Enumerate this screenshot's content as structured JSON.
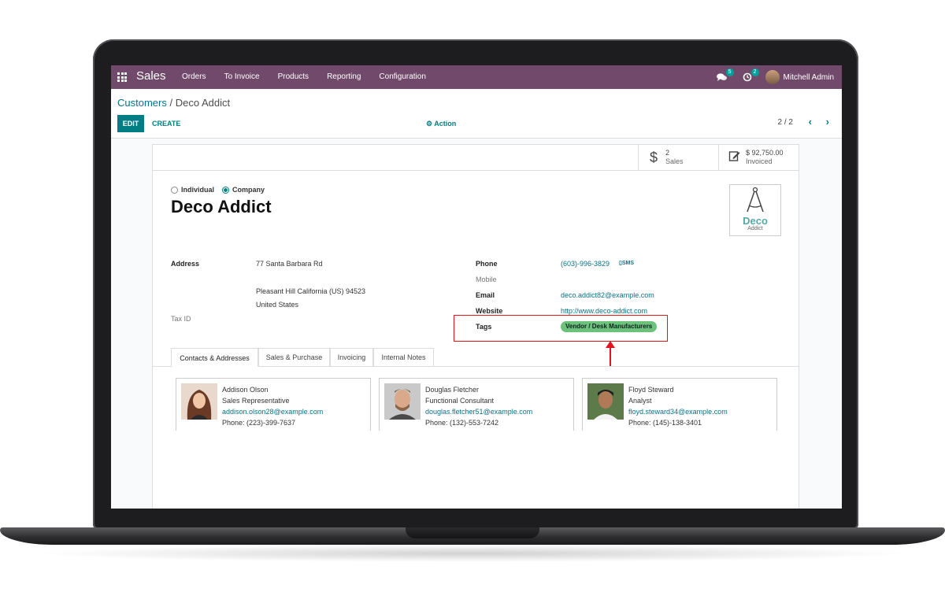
{
  "navbar": {
    "app_name": "Sales",
    "menu": [
      "Orders",
      "To Invoice",
      "Products",
      "Reporting",
      "Configuration"
    ],
    "messages_count": "5",
    "activities_count": "2",
    "user_name": "Mitchell Admin"
  },
  "control": {
    "breadcrumb_parent": "Customers",
    "breadcrumb_separator": " / ",
    "breadcrumb_current": "Deco Addict",
    "edit_label": "EDIT",
    "create_label": "CREATE",
    "action_label": "Action",
    "pager": "2 / 2"
  },
  "stats": {
    "sales_value": "2",
    "sales_label": "Sales",
    "invoiced_value": "$ 92,750.00",
    "invoiced_label": "Invoiced"
  },
  "form": {
    "type_individual": "Individual",
    "type_company": "Company",
    "company_name": "Deco Addict",
    "logo_word": "Deco",
    "logo_sub": "Addict",
    "address_label": "Address",
    "street": "77 Santa Barbara Rd",
    "city_line": "Pleasant Hill  California (US)  94523",
    "country": "United States",
    "taxid_label": "Tax ID",
    "phone_label": "Phone",
    "phone": "(603)-996-3829",
    "sms_label": "SMS",
    "mobile_label": "Mobile",
    "email_label": "Email",
    "email": "deco.addict82@example.com",
    "website_label": "Website",
    "website": "http://www.deco-addict.com",
    "tags_label": "Tags",
    "tag": "Vendor / Desk Manufacturers",
    "tag_color": "#6cc17b",
    "highlight_color": "#e0151d"
  },
  "tabs": [
    "Contacts & Addresses",
    "Sales & Purchase",
    "Invoicing",
    "Internal Notes"
  ],
  "contacts": [
    {
      "name": "Addison Olson",
      "role": "Sales Representative",
      "email": "addison.olson28@example.com",
      "phone": "Phone: (223)-399-7637"
    },
    {
      "name": "Douglas Fletcher",
      "role": "Functional Consultant",
      "email": "douglas.fletcher51@example.com",
      "phone": "Phone: (132)-553-7242"
    },
    {
      "name": "Floyd Steward",
      "role": "Analyst",
      "email": "floyd.steward34@example.com",
      "phone": "Phone: (145)-138-3401"
    }
  ],
  "colors": {
    "navbar": "#71496a",
    "primary": "#017e84",
    "link": "#0a7188"
  }
}
